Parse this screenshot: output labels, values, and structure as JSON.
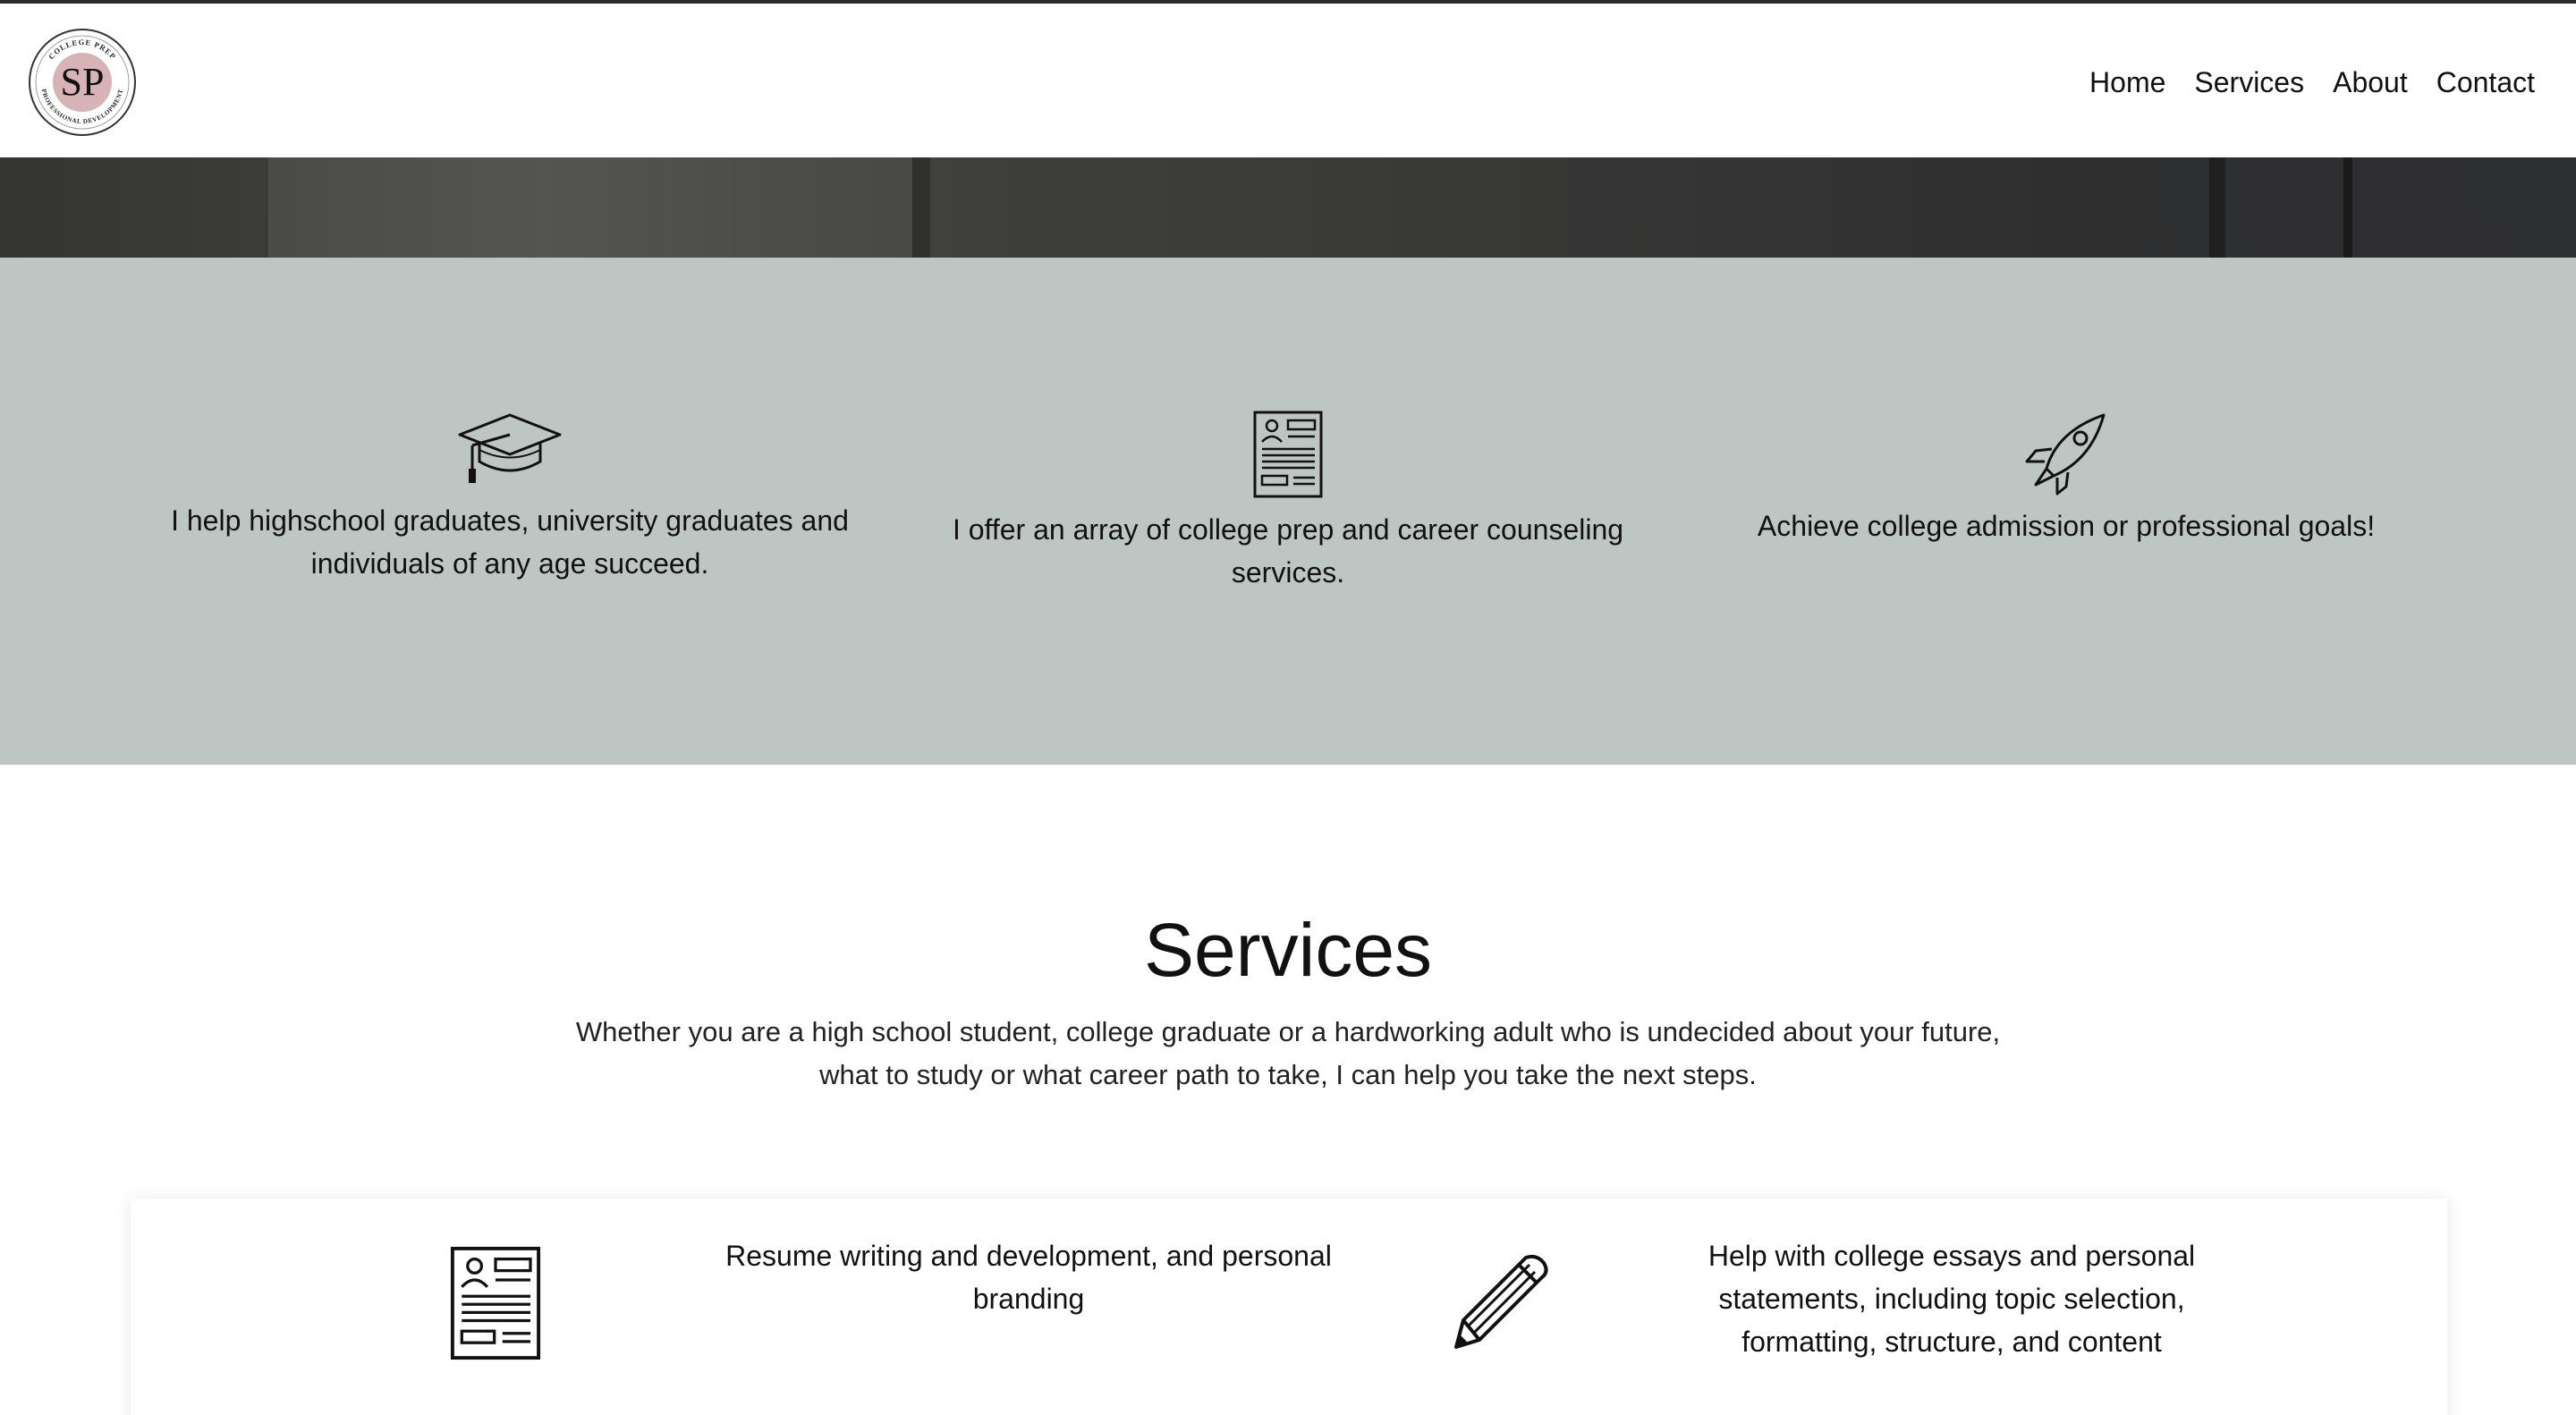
{
  "header": {
    "logo": {
      "initials": "SP",
      "ring_top_text": "COLLEGE PREP",
      "ring_bottom_text": "PROFESSIONAL DEVELOPMENT",
      "accent_color": "#d7b3b6"
    },
    "nav": [
      {
        "label": "Home"
      },
      {
        "label": "Services"
      },
      {
        "label": "About"
      },
      {
        "label": "Contact"
      }
    ]
  },
  "features": [
    {
      "icon": "graduation-cap-icon",
      "text_line1": "I help highschool graduates, university graduates and",
      "text_line2": "individuals of any age succeed."
    },
    {
      "icon": "resume-document-icon",
      "text_line1": "I offer an array of college prep and career counseling",
      "text_line2": "services."
    },
    {
      "icon": "rocket-icon",
      "text_line1": "Achieve college admission or professional goals!",
      "text_line2": ""
    }
  ],
  "services": {
    "title": "Services",
    "intro_line1": "Whether you are a high school student, college graduate or a hardworking adult who is undecided about your future,",
    "intro_line2": "what to study or what career path to take, I can help you take the next steps.",
    "items": [
      {
        "icon": "resume-document-icon",
        "line1": "Resume writing and development, and personal",
        "line2": "branding",
        "line3": ""
      },
      {
        "icon": "pencil-icon",
        "line1": "Help with college essays and personal",
        "line2": "statements, including topic selection,",
        "line3": "formatting, structure, and content"
      }
    ]
  },
  "colors": {
    "band_background": "#bec6c4",
    "text": "#111111",
    "header_border": "#2b2b2b"
  }
}
